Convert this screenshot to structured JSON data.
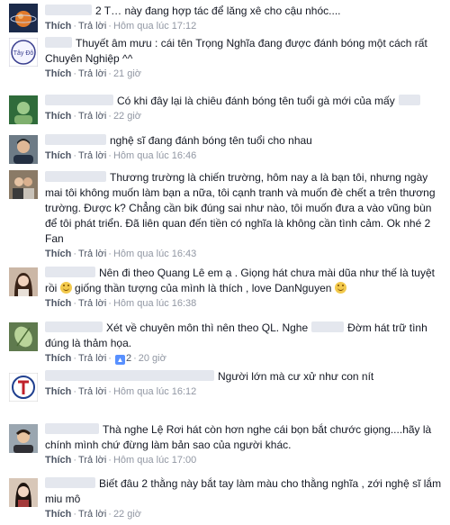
{
  "comments": [
    {
      "text": "2 T… này đang hợp tác để lăng xê cho cậu nhóc....",
      "actions": {
        "like": "Thích",
        "reply": "Trả lời"
      },
      "likes": "",
      "time": "Hôm qua lúc 17:12",
      "avatar": "avatar-planet"
    },
    {
      "text": "Thuyết âm mưu : cái tên Trọng Nghĩa đang được đánh bóng một cách rất Chuyên Nghiệp ^^",
      "actions": {
        "like": "Thích",
        "reply": "Trả lời"
      },
      "likes": "",
      "time": "21 giờ",
      "avatar": "avatar-tay-do",
      "avatar_label": "Tây Đô"
    },
    {
      "text": "Có khi đây lại là chiêu đánh bóng tên tuổi gà mới của mấy",
      "actions": {
        "like": "Thích",
        "reply": "Trả lời"
      },
      "likes": "",
      "time": "22 giờ",
      "avatar": "avatar-green"
    },
    {
      "text": "nghệ sĩ đang đánh bóng tên tuổi cho nhau",
      "actions": {
        "like": "Thích",
        "reply": "Trả lời"
      },
      "likes": "",
      "time": "Hôm qua lúc 16:46",
      "avatar": "avatar-man"
    },
    {
      "text": "Thương trường là chiến trường, hôm nay a là bạn tôi, nhưng ngày mai tôi không muốn làm bạn a nữa, tôi cạnh tranh và muốn đè chết a trên thương trường. Được k? Chẳng cần bik đúng sai như nào, tôi muốn đưa a vào vũng bùn để tôi phát triển. Đã liên quan đến tiền có nghĩa là không cần tình cảm. Ok nhé 2 Fan",
      "actions": {
        "like": "Thích",
        "reply": "Trả lời"
      },
      "likes": "",
      "time": "Hôm qua lúc 16:43",
      "avatar": "avatar-couple"
    },
    {
      "text": "Nên đi theo Quang Lê em ạ . Giọng hát chưa mài dũa như thế là tuyệt rồi",
      "text2": "giống thần tượng của mình là thích , love DanNguyen",
      "actions": {
        "like": "Thích",
        "reply": "Trả lời"
      },
      "likes": "",
      "time": "Hôm qua lúc 16:38",
      "avatar": "avatar-girl"
    },
    {
      "text": "Xét về chuyên môn thì nên theo QL. Nghe",
      "text2": "Đờm hát trữ tình đúng là thảm họa.",
      "actions": {
        "like": "Thích",
        "reply": "Trả lời"
      },
      "likes": "2",
      "time": "20 giờ",
      "avatar": "avatar-leaf"
    },
    {
      "text": "Người lớn mà cư xử như con nít",
      "actions": {
        "like": "Thích",
        "reply": "Trả lời"
      },
      "likes": "",
      "time": "Hôm qua lúc 16:12",
      "avatar": "avatar-logo"
    },
    {
      "text": "Thà nghe Lệ Rơi hát còn hơn nghe cái bọn bắt chước giọng....hãy là chính mình chứ đừng làm bản sao của người khác.",
      "actions": {
        "like": "Thích",
        "reply": "Trả lời"
      },
      "likes": "",
      "time": "Hôm qua lúc 17:00",
      "avatar": "avatar-smile"
    },
    {
      "text": "Biết đâu 2 thằng này bắt tay làm màu cho thằng nghĩa , zới nghệ sĩ lắm miu mô",
      "actions": {
        "like": "Thích",
        "reply": "Trả lời"
      },
      "likes": "",
      "time": "22 giờ",
      "avatar": "avatar-woman"
    }
  ],
  "colors": {
    "text": "#141823",
    "meta": "#9197a3",
    "link": "#4e5665",
    "like_badge": "#5890ff"
  }
}
